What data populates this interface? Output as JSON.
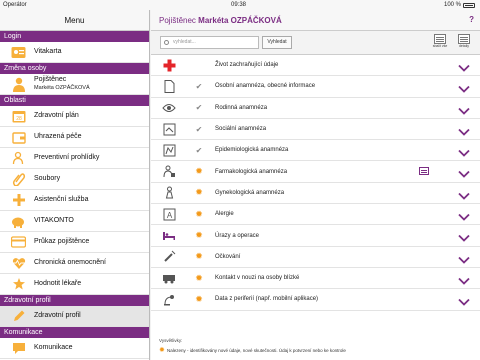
{
  "status": {
    "operator": "Operátor",
    "time": "09:38",
    "battery": "100 %"
  },
  "sidebar": {
    "title": "Menu",
    "sections": [
      {
        "label": "Login",
        "items": [
          {
            "label": "Vitakarta",
            "icon": "id-card-icon"
          }
        ]
      },
      {
        "label": "Změna osoby",
        "items": [
          {
            "label": "Pojištěnec",
            "sub": "Markéta OZPÁČKOVÁ",
            "icon": "person-icon"
          }
        ]
      },
      {
        "label": "Oblasti",
        "items": [
          {
            "label": "Zdravotní plán",
            "icon": "calendar-icon"
          },
          {
            "label": "Uhrazená péče",
            "icon": "wallet-icon"
          },
          {
            "label": "Preventivní prohlídky",
            "icon": "person-check-icon"
          },
          {
            "label": "Soubory",
            "icon": "paperclip-icon"
          },
          {
            "label": "Asistenční služba",
            "icon": "headset-icon"
          },
          {
            "label": "VITAKONTO",
            "icon": "piggy-bank-icon"
          },
          {
            "label": "Průkaz pojištěnce",
            "icon": "card-icon"
          },
          {
            "label": "Chronická onemocnění",
            "icon": "heart-pulse-icon"
          },
          {
            "label": "Hodnotit lékaře",
            "icon": "star-doctor-icon"
          }
        ]
      },
      {
        "label": "Zdravotní profil",
        "items": [
          {
            "label": "Zdravotní profil",
            "icon": "pencil-icon",
            "selected": true
          }
        ]
      },
      {
        "label": "Komunikace",
        "items": [
          {
            "label": "Komunikace",
            "icon": "chat-icon"
          }
        ]
      }
    ]
  },
  "header": {
    "prefix": "Pojištěnec",
    "name": "Markéta OZPÁČKOVÁ",
    "help": "?"
  },
  "search": {
    "placeholder": "vyhledat...",
    "button": "Vyhledat",
    "tool1": "sbalit vše",
    "tool2": "detaily"
  },
  "rows": [
    {
      "label": "Život zachraňující údaje",
      "icon": "red-cross-icon",
      "mark": ""
    },
    {
      "label": "Osobní anamnéza, obecné informace",
      "icon": "document-icon",
      "mark": "check"
    },
    {
      "label": "Rodinná anamnéza",
      "icon": "eye-icon",
      "mark": "check"
    },
    {
      "label": "Sociální anamnéza",
      "icon": "social-icon",
      "mark": "check"
    },
    {
      "label": "Epidemiologická anamnéza",
      "icon": "epidemic-icon",
      "mark": "check"
    },
    {
      "label": "Farmakologická anamnéza",
      "icon": "pill-person-icon",
      "mark": "sun",
      "extra": true
    },
    {
      "label": "Gynekologická anamnéza",
      "icon": "gyn-icon",
      "mark": "sun"
    },
    {
      "label": "Alergie",
      "icon": "allergy-icon",
      "mark": "sun"
    },
    {
      "label": "Úrazy a operace",
      "icon": "bed-icon",
      "mark": "sun"
    },
    {
      "label": "Očkování",
      "icon": "syringe-icon",
      "mark": "sun"
    },
    {
      "label": "Kontakt v nouzi na osoby blízké",
      "icon": "ambulance-icon",
      "mark": "sun"
    },
    {
      "label": "Data z periferií (např. mobilní aplikace)",
      "icon": "satellite-icon",
      "mark": "sun"
    }
  ],
  "legend": {
    "title": "Vysvětlivky:",
    "text": "Nalezeny - identifikovány nové údaje, nové skutečnosti. Údaj k potvrzení nebo ke kontrole"
  },
  "colors": {
    "accent": "#7b2d83",
    "sun": "#f39a1b",
    "red": "#e4252a"
  }
}
